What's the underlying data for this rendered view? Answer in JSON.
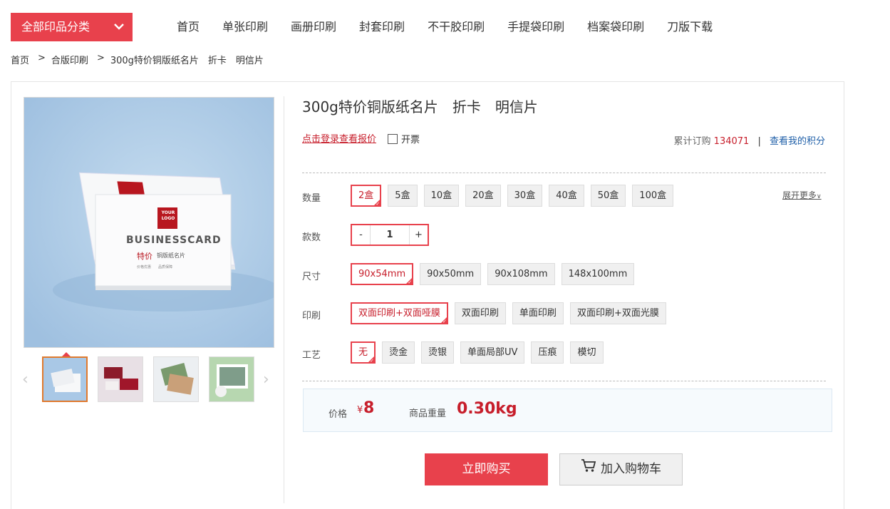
{
  "nav": {
    "category_label": "全部印品分类",
    "items": [
      "首页",
      "单张印刷",
      "画册印刷",
      "封套印刷",
      "不干胶印刷",
      "手提袋印刷",
      "档案袋印刷",
      "刀版下载"
    ]
  },
  "breadcrumb": [
    "首页",
    "合版印刷",
    "300g特价铜版纸名片　折卡　明信片"
  ],
  "breadcrumb_sep": ">",
  "product": {
    "title": "300g特价铜版纸名片　折卡　明信片",
    "login_link": "点击登录查看报价",
    "invoice_label": "开票",
    "orders_label": "累计订购",
    "orders_count": "134071",
    "orders_sep": "|",
    "points_link": "查看我的积分",
    "card_text": {
      "logo": "YOUR LOGO",
      "brand": "BUSINESSCARD",
      "tag1": "特价",
      "tag2": "铜版纸名片",
      "foot": "价格优惠　　品质保障"
    }
  },
  "options": {
    "quantity": {
      "label": "数量",
      "values": [
        "2盒",
        "5盒",
        "10盒",
        "20盒",
        "30盒",
        "40盒",
        "50盒",
        "100盒"
      ],
      "selected": 0,
      "expand": "展开更多"
    },
    "count": {
      "label": "款数",
      "value": "1",
      "minus": "-",
      "plus": "+"
    },
    "size": {
      "label": "尺寸",
      "values": [
        "90x54mm",
        "90x50mm",
        "90x108mm",
        "148x100mm"
      ],
      "selected": 0
    },
    "print": {
      "label": "印刷",
      "values": [
        "双面印刷+双面哑膜",
        "双面印刷",
        "单面印刷",
        "双面印刷+双面光膜"
      ],
      "selected": 0
    },
    "craft": {
      "label": "工艺",
      "values": [
        "无",
        "烫金",
        "烫银",
        "单面局部UV",
        "压痕",
        "模切"
      ],
      "selected": 0
    }
  },
  "price": {
    "label": "价格",
    "currency": "¥",
    "value": "8",
    "weight_label": "商品重量",
    "weight_value": "0.30kg"
  },
  "actions": {
    "buy": "立即购买",
    "cart": "加入购物车"
  },
  "colors": {
    "accent": "#e8414c",
    "price": "#c71e2b",
    "link": "#1f5fa8"
  }
}
